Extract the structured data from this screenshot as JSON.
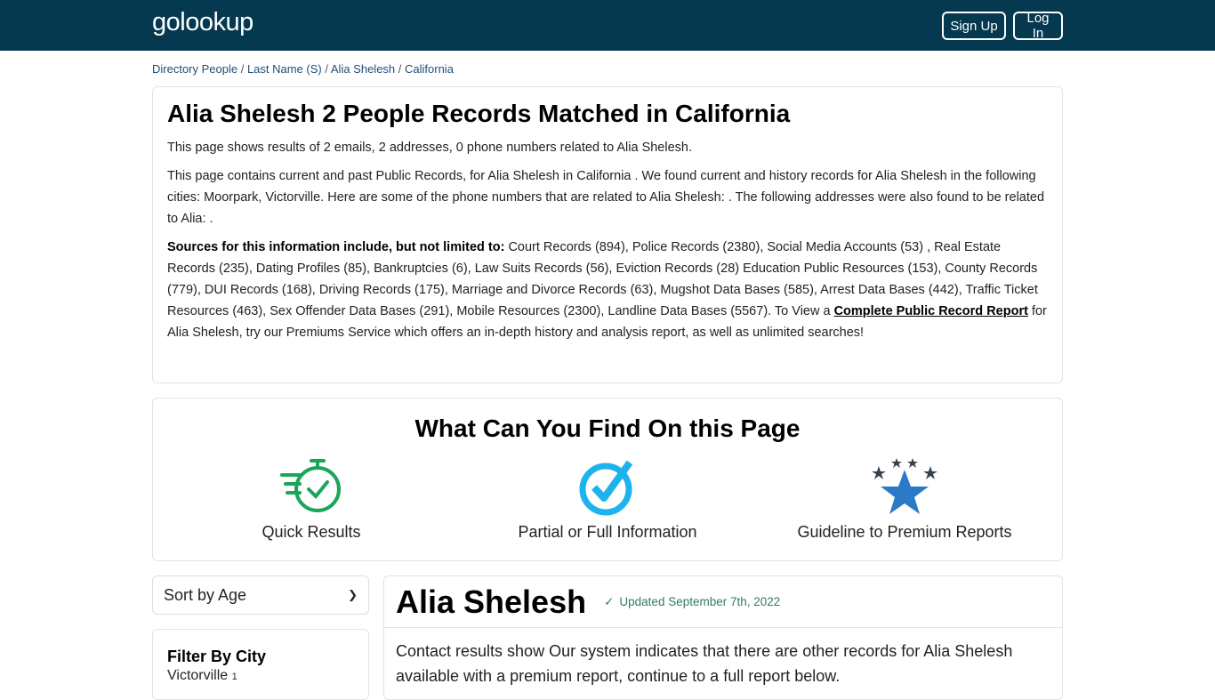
{
  "navbar": {
    "logo": "golookup",
    "signup_label": "Sign Up",
    "login_label": "Log In"
  },
  "breadcrumb": {
    "items": [
      "Directory People",
      "Last Name (S)",
      "Alia Shelesh",
      "California"
    ],
    "separator": " / "
  },
  "intro": {
    "title": "Alia Shelesh 2 People Records Matched in California",
    "summary": "This page shows results of 2 emails, 2 addresses, 0 phone numbers related to Alia Shelesh.",
    "description": "This page contains current and past Public Records, for Alia Shelesh in California . We found current and history records for Alia Shelesh in the following cities: Moorpark, Victorville. Here are some of the phone numbers that are related to Alia Shelesh: . The following addresses were also found to be related to Alia: .",
    "sources_label": "Sources for this information include, but not limited to:",
    "sources_text": " Court Records (894), Police Records (2380), Social Media Accounts (53) , Real Estate Records (235), Dating Profiles (85), Bankruptcies (6), Law Suits Records (56), Eviction Records (28) Education Public Resources (153), County Records (779), DUI Records (168), Driving Records (175), Marriage and Divorce Records (63), Mugshot Data Bases (585), Arrest Data Bases (442), Traffic Ticket Resources (463), Sex Offender Data Bases (291), Mobile Resources (2300), Landline Data Bases (5567). To View a ",
    "report_link": "Complete Public Record Report",
    "closing_text": " for Alia Shelesh, try our Premiums Service which offers an in-depth history and analysis report, as well as unlimited searches!"
  },
  "find": {
    "title": "What Can You Find On this Page",
    "features": [
      {
        "label": "Quick Results",
        "icon": "stopwatch-check-icon",
        "color": "#1aa55a"
      },
      {
        "label": "Partial or Full Information",
        "icon": "circle-check-icon",
        "color": "#1fb3ee"
      },
      {
        "label": "Guideline to Premium Reports",
        "icon": "stars-icon",
        "color": "#2a7ac7"
      }
    ]
  },
  "sort": {
    "selected": "Sort by Age"
  },
  "filter": {
    "title": "Filter By City",
    "cities": [
      {
        "name": "Victorville",
        "count": "1"
      }
    ]
  },
  "result": {
    "name": "Alia Shelesh",
    "updated": "Updated September 7th, 2022",
    "body": "Contact results show Our system indicates that there are other records for Alia Shelesh available with a premium report, continue to a full report below."
  },
  "colors": {
    "navbar": "#04394f",
    "updated_green": "#2e7d5b"
  }
}
